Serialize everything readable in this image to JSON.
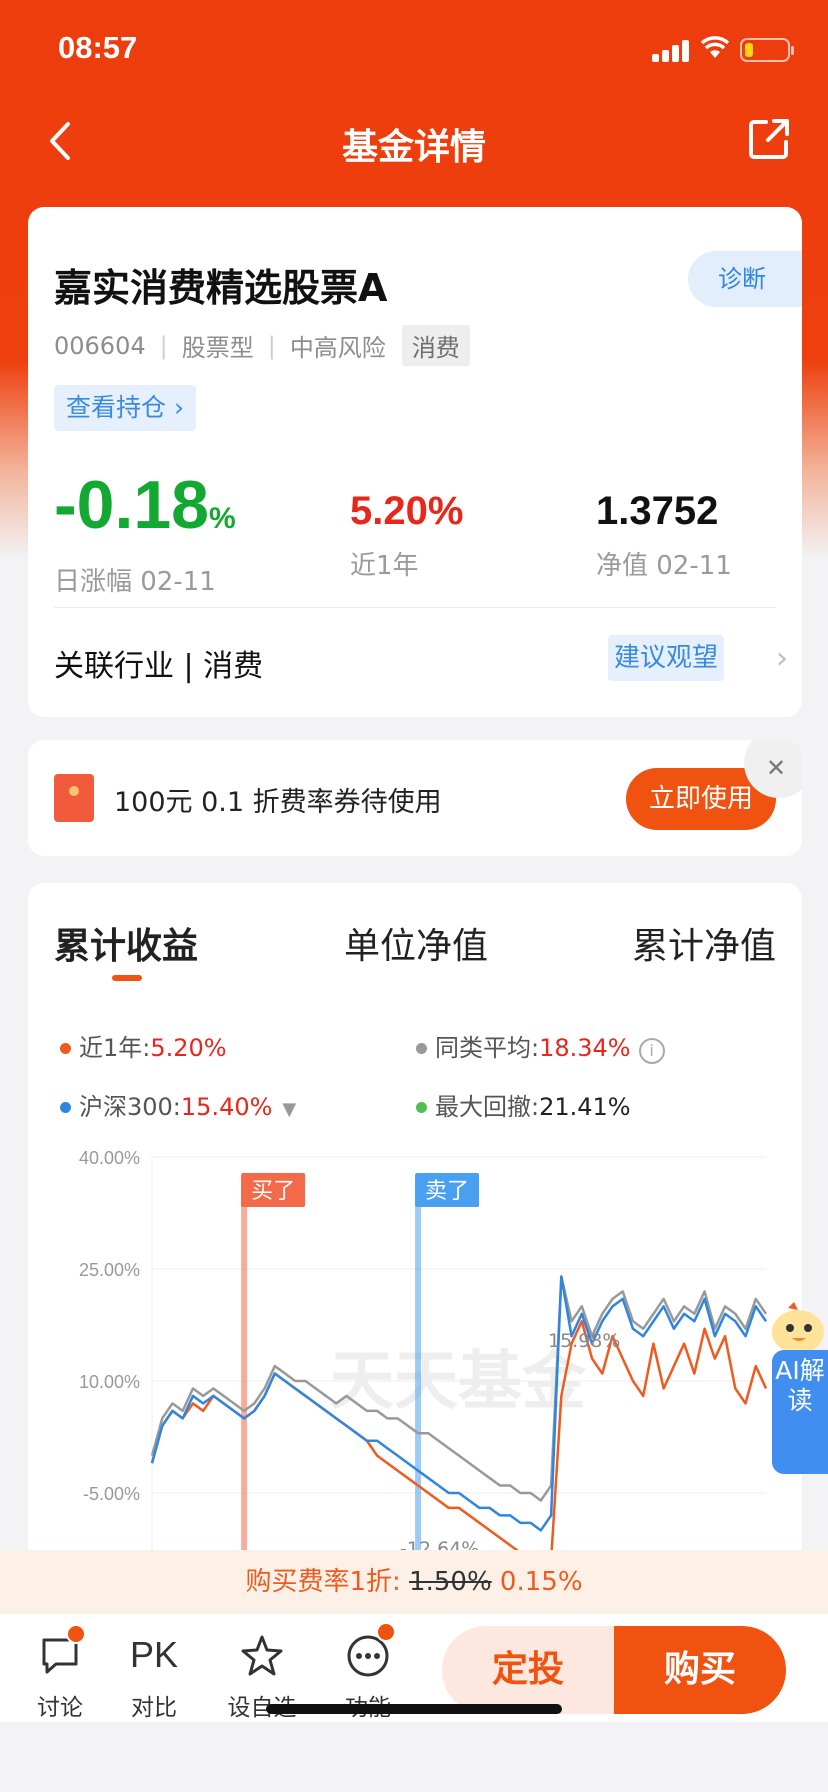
{
  "status_bar": {
    "time": "08:57"
  },
  "nav": {
    "title": "基金详情"
  },
  "fund": {
    "name": "嘉实消费精选股票A",
    "code": "006604",
    "type": "股票型",
    "risk": "中高风险",
    "tag": "消费",
    "diagnose_label": "诊断",
    "holdings_label": "查看持仓 ›",
    "daily_change": "-0.18",
    "daily_change_unit": "%",
    "daily_change_label": "日涨幅 02-11",
    "year_return": "5.20%",
    "year_return_label": "近1年",
    "nav_value": "1.3752",
    "nav_label": "净值 02-11",
    "industry": "关联行业 | 消费",
    "advice": "建议观望"
  },
  "coupon": {
    "text": "100元 0.1 折费率券待使用",
    "button": "立即使用"
  },
  "chart_tabs": [
    "累计收益",
    "单位净值",
    "累计净值"
  ],
  "legend": {
    "fund": {
      "label": "近1年:",
      "value": "5.20%",
      "color": "#f05a1f"
    },
    "peer": {
      "label": "同类平均:",
      "value": "18.34%",
      "color": "#999999"
    },
    "index": {
      "label": "沪深300:",
      "value": "15.40%",
      "color": "#2f86e0"
    },
    "drawdown": {
      "label": "最大回撤:",
      "value": "21.41%",
      "color": "#4fbf4f"
    }
  },
  "chart_data": {
    "type": "line",
    "ylim": [
      -5,
      40
    ],
    "yticks": [
      "40.00%",
      "25.00%",
      "10.00%",
      "-5.00%"
    ],
    "x": [
      0,
      1,
      2,
      3,
      4,
      5,
      6,
      7,
      8,
      9,
      10,
      11,
      12,
      13,
      14,
      15,
      16,
      17,
      18,
      19,
      20,
      21,
      22,
      23,
      24,
      25,
      26,
      27,
      28,
      29,
      30,
      31,
      32,
      33,
      34,
      35,
      36,
      37,
      38,
      39,
      40,
      41,
      42,
      43,
      44,
      45,
      46,
      47,
      48,
      49,
      50,
      51,
      52,
      53,
      54,
      55,
      56,
      57,
      58,
      59,
      60
    ],
    "series": [
      {
        "name": "近1年",
        "color": "#f05a1f",
        "values": [
          -1,
          4,
          6,
          5,
          7,
          6,
          8,
          7,
          6,
          5,
          6,
          8,
          11,
          10,
          9,
          8,
          7,
          6,
          5,
          4,
          3,
          2,
          0,
          -1,
          -2,
          -3,
          -4,
          -5,
          -6,
          -7,
          -7,
          -8,
          -9,
          -10,
          -11,
          -12,
          -13,
          -13,
          -14,
          -14,
          8,
          15,
          18,
          13,
          11,
          16,
          13,
          10,
          8,
          15,
          9,
          12,
          15,
          11,
          17,
          13,
          16,
          9,
          7,
          12,
          9
        ]
      },
      {
        "name": "同类平均",
        "color": "#999999",
        "values": [
          0,
          5,
          7,
          6,
          9,
          8,
          9,
          8,
          7,
          6,
          7,
          9,
          12,
          11,
          10,
          10,
          9,
          8,
          7,
          8,
          7,
          6,
          6,
          5,
          5,
          4,
          3,
          3,
          2,
          1,
          0,
          -1,
          -2,
          -3,
          -4,
          -4,
          -5,
          -5,
          -6,
          -4,
          24,
          18,
          20,
          16,
          19,
          21,
          22,
          18,
          17,
          19,
          21,
          18,
          20,
          19,
          22,
          17,
          20,
          19,
          17,
          21,
          19
        ]
      },
      {
        "name": "沪深300",
        "color": "#2f86e0",
        "values": [
          -1,
          4,
          6,
          5,
          8,
          7,
          8,
          7,
          6,
          5,
          6,
          8,
          11,
          10,
          9,
          8,
          7,
          6,
          5,
          4,
          3,
          2,
          2,
          1,
          0,
          -1,
          -2,
          -3,
          -4,
          -5,
          -5,
          -6,
          -7,
          -7,
          -8,
          -8,
          -9,
          -9,
          -10,
          -8,
          24,
          16,
          19,
          15,
          18,
          20,
          21,
          17,
          16,
          18,
          20,
          17,
          19,
          18,
          21,
          16,
          19,
          18,
          16,
          20,
          18
        ]
      }
    ],
    "markers": [
      {
        "label": "买了",
        "x": 9
      },
      {
        "label": "卖了",
        "x": 26
      }
    ],
    "annotations": [
      "15.98%",
      "-12.64%"
    ],
    "watermark": "天天基金"
  },
  "fee_bar": {
    "prefix": "购买费率1折: ",
    "original": "1.50%",
    "discounted": "0.15%"
  },
  "bottom_nav": [
    {
      "label": "讨论"
    },
    {
      "label": "对比",
      "icon_text": "PK"
    },
    {
      "label": "设自选"
    },
    {
      "label": "功能"
    }
  ],
  "actions": {
    "dingtou": "定投",
    "buy": "购买"
  },
  "ai_assist": {
    "label": "AI解读"
  }
}
